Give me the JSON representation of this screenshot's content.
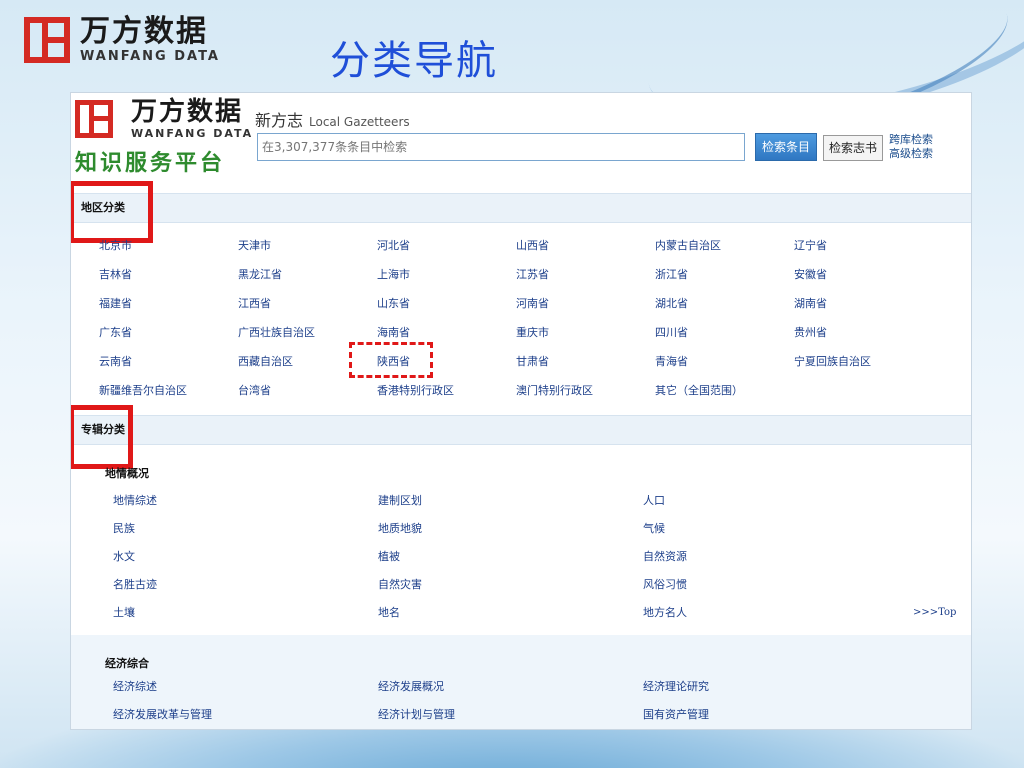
{
  "slide": {
    "logo_cn": "万方数据",
    "logo_en": "WANFANG DATA",
    "title": "分类导航"
  },
  "site": {
    "logo_cn": "万方数据",
    "logo_en": "WANFANG DATA",
    "platform": "知识服务平台",
    "name": "新方志",
    "name_en": "Local Gazetteers",
    "search_placeholder": "在3,307,377条条目中检索",
    "btn_search_entries": "检索条目",
    "btn_search_books": "检索志书",
    "link_cross": "跨库检索",
    "link_advanced": "高级检索"
  },
  "region": {
    "heading": "地区分类",
    "items": [
      "北京市",
      "天津市",
      "河北省",
      "山西省",
      "内蒙古自治区",
      "辽宁省",
      "吉林省",
      "黑龙江省",
      "上海市",
      "江苏省",
      "浙江省",
      "安徽省",
      "福建省",
      "江西省",
      "山东省",
      "河南省",
      "湖北省",
      "湖南省",
      "广东省",
      "广西壮族自治区",
      "海南省",
      "重庆市",
      "四川省",
      "贵州省",
      "云南省",
      "西藏自治区",
      "陕西省",
      "甘肃省",
      "青海省",
      "宁夏回族自治区",
      "新疆维吾尔自治区",
      "台湾省",
      "香港特别行政区",
      "澳门特别行政区",
      "其它（全国范围）"
    ]
  },
  "topic": {
    "heading": "专辑分类",
    "groups": [
      {
        "title": "地情概况",
        "items": [
          "地情综述",
          "建制区划",
          "人口",
          "民族",
          "地质地貌",
          "气候",
          "水文",
          "植被",
          "自然资源",
          "名胜古迹",
          "自然灾害",
          "风俗习惯",
          "土壤",
          "地名",
          "地方名人"
        ]
      },
      {
        "title": "经济综合",
        "items": [
          "经济综述",
          "经济发展概况",
          "经济理论研究",
          "经济发展改革与管理",
          "经济计划与管理",
          "国有资产管理"
        ]
      }
    ],
    "top_link": ">>>Top"
  },
  "colors": {
    "accent_red": "#e01818",
    "title_blue": "#1f4fd8",
    "link_blue": "#1d3f8a",
    "platform_green": "#2e8b2e"
  }
}
